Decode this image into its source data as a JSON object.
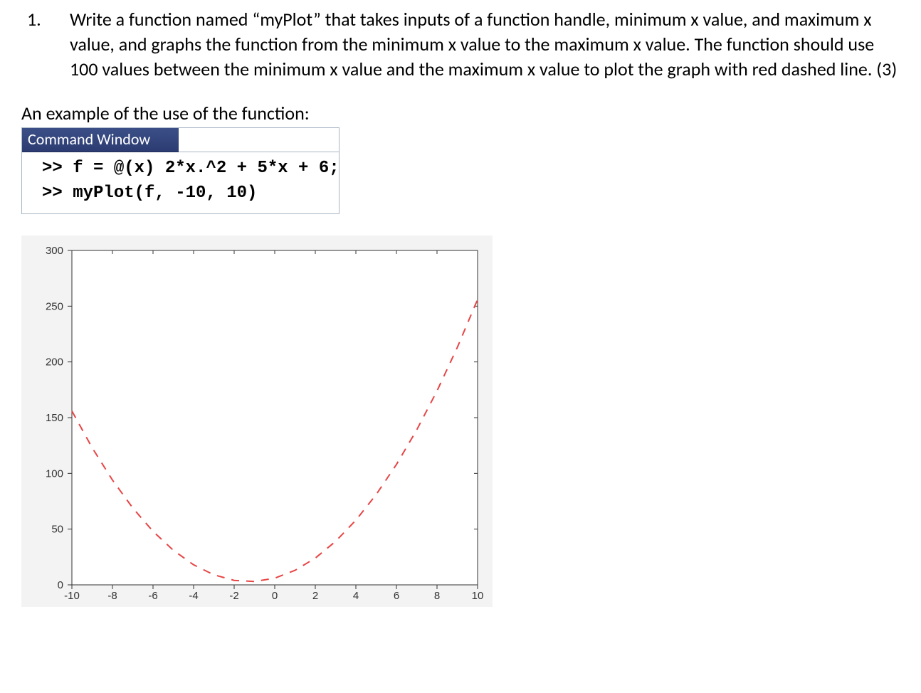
{
  "question": {
    "number": "1.",
    "text": "Write a function named “myPlot” that takes inputs of a function handle, minimum x value, and maximum x value, and graphs the function from the minimum x value to the maximum x value. The function should use 100 values between the minimum x value and the maximum x value to plot the graph with red dashed line.  (3)"
  },
  "example_intro": "An example of the use of the function:",
  "command_window": {
    "title": "Command Window",
    "lines": [
      ">> f = @(x) 2*x.^2 + 5*x + 6;",
      ">> myPlot(f, -10, 10)"
    ]
  },
  "chart_data": {
    "type": "line",
    "title": "",
    "xlabel": "",
    "ylabel": "",
    "xlim": [
      -10,
      10
    ],
    "ylim": [
      0,
      300
    ],
    "x_ticks": [
      -10,
      -8,
      -6,
      -4,
      -2,
      0,
      2,
      4,
      6,
      8,
      10
    ],
    "y_ticks": [
      0,
      50,
      100,
      150,
      200,
      250,
      300
    ],
    "series": [
      {
        "name": "2*x.^2 + 5*x + 6",
        "style": "red-dashed",
        "x": [
          -10,
          -9,
          -8,
          -7,
          -6,
          -5,
          -4,
          -3,
          -2,
          -1,
          0,
          1,
          2,
          3,
          4,
          5,
          6,
          7,
          8,
          9,
          10
        ],
        "y": [
          156,
          123,
          94,
          69,
          48,
          31,
          18,
          9,
          4,
          3,
          6,
          13,
          24,
          39,
          58,
          81,
          108,
          139,
          174,
          213,
          256
        ]
      }
    ]
  }
}
